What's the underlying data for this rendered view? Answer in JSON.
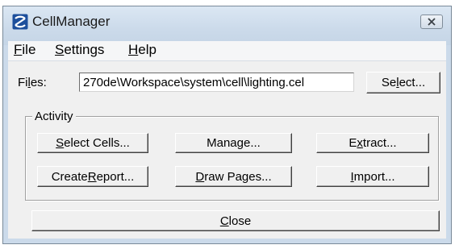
{
  "window": {
    "title": "CellManager",
    "close_icon": "close-icon"
  },
  "menu": [
    {
      "accel": "F",
      "rest": "ile"
    },
    {
      "accel": "S",
      "rest": "ettings"
    },
    {
      "accel": "H",
      "rest": "elp"
    }
  ],
  "files": {
    "label_pre": "Fi",
    "label_accel": "l",
    "label_post": "es:",
    "value": "270de\\Workspace\\system\\cell\\lighting.cel",
    "select_pre": "Se",
    "select_accel": "l",
    "select_post": "ect..."
  },
  "activity": {
    "legend": "Activity",
    "buttons": [
      {
        "pre": "",
        "accel": "S",
        "post": "elect Cells..."
      },
      {
        "pre": "Mana",
        "accel": "g",
        "post": "e..."
      },
      {
        "pre": "E",
        "accel": "x",
        "post": "tract..."
      },
      {
        "pre": "Create ",
        "accel": "R",
        "post": "eport..."
      },
      {
        "pre": "",
        "accel": "D",
        "post": "raw Pages..."
      },
      {
        "pre": "",
        "accel": "I",
        "post": "mport..."
      }
    ]
  },
  "close_button": {
    "pre": "",
    "accel": "C",
    "post": "lose"
  }
}
